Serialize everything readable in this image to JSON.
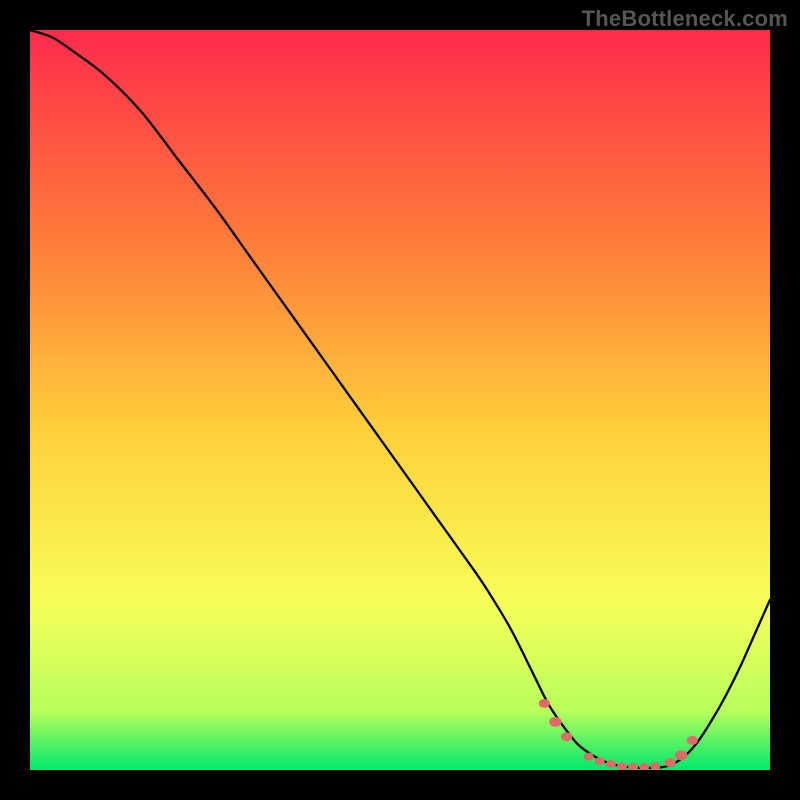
{
  "watermark": "TheBottleneck.com",
  "colors": {
    "page_bg": "#000000",
    "gradient_top": "#ff2b4b",
    "gradient_mid1": "#ff7a3a",
    "gradient_mid2": "#ffd23a",
    "gradient_mid3": "#f6ff5a",
    "gradient_lime": "#b8ff5a",
    "gradient_bottom": "#00e86b",
    "curve": "#000000",
    "marker_fill": "#e06a6a",
    "marker_stroke": "#b94b4b"
  },
  "chart_data": {
    "type": "line",
    "title": "",
    "xlabel": "",
    "ylabel": "",
    "xlim": [
      0,
      100
    ],
    "ylim": [
      0,
      100
    ],
    "grid": false,
    "legend": false,
    "series": [
      {
        "name": "bottleneck-curve",
        "x": [
          0,
          3,
          6,
          10,
          15,
          20,
          25,
          30,
          35,
          40,
          45,
          50,
          55,
          60,
          62,
          65,
          68,
          70,
          72,
          74,
          76,
          78,
          80,
          82,
          84,
          86,
          88,
          90,
          92,
          94,
          96,
          98,
          100
        ],
        "y": [
          100,
          99,
          97,
          94,
          89,
          82.5,
          76,
          69,
          62,
          55,
          48,
          41,
          34,
          27,
          24,
          19,
          13,
          9,
          6,
          3.5,
          2,
          1,
          0.5,
          0.3,
          0.3,
          0.5,
          1.5,
          3.5,
          6.5,
          10,
          14,
          18.5,
          23
        ]
      }
    ],
    "markers": {
      "name": "highlight-points",
      "x": [
        69.5,
        71,
        72.5,
        75.5,
        77,
        78.5,
        80,
        81.5,
        83,
        84.5,
        86.5,
        88,
        89.5
      ],
      "y": [
        9,
        6.5,
        4.5,
        1.8,
        1.2,
        0.8,
        0.5,
        0.4,
        0.4,
        0.5,
        1,
        2,
        4
      ],
      "size": [
        4.5,
        5,
        4.5,
        4,
        4,
        4,
        4,
        4,
        4,
        4,
        4.5,
        5,
        4.5
      ]
    }
  }
}
